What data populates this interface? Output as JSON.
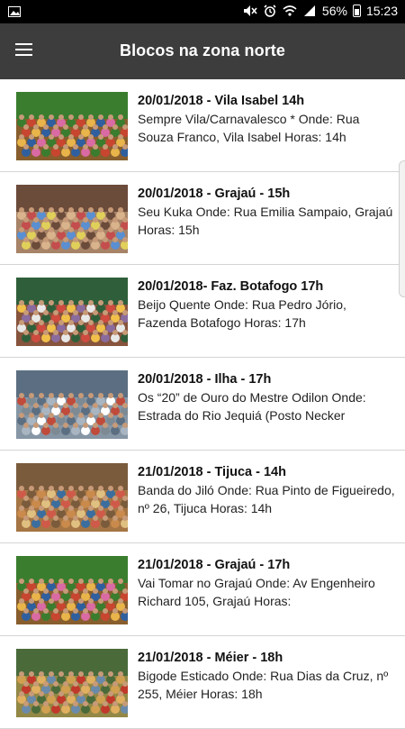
{
  "status_bar": {
    "battery": "56%",
    "time": "15:23",
    "icons": [
      "image-icon",
      "mute-icon",
      "alarm-icon",
      "wifi-icon",
      "signal-icon",
      "battery-icon"
    ]
  },
  "app_bar": {
    "title": "Blocos na zona norte",
    "menu_icon": "hamburger-menu-icon"
  },
  "items": [
    {
      "title": "20/01/2018 - Vila Isabel 14h",
      "desc": "Sempre Vila/Carnavalesco * Onde: Rua Souza Franco, Vila Isabel Horas: 14h"
    },
    {
      "title": "20/01/2018 - Grajaú - 15h",
      "desc": "Seu Kuka Onde: Rua Emilia Sampaio, Grajaú Horas: 15h"
    },
    {
      "title": "20/01/2018- Faz. Botafogo 17h",
      "desc": "Beijo Quente Onde: Rua Pedro Jório, Fazenda Botafogo Horas: 17h"
    },
    {
      "title": "20/01/2018 - Ilha - 17h",
      "desc": "Os “20” de Ouro do Mestre Odilon Onde: Estrada do Rio Jequiá (Posto Necker"
    },
    {
      "title": "21/01/2018 - Tijuca - 14h",
      "desc": "Banda do Jiló Onde: Rua Pinto de Figueiredo, nº 26, Tijuca Horas: 14h"
    },
    {
      "title": "21/01/2018 - Grajaú - 17h",
      "desc": "Vai Tomar no Grajaú Onde: Av Engenheiro Richard 105, Grajaú Horas:"
    },
    {
      "title": "21/01/2018 - Méier - 18h",
      "desc": "Bigode Esticado Onde: Rua Dias da Cruz, nº 255, Méier Horas: 18h"
    }
  ]
}
